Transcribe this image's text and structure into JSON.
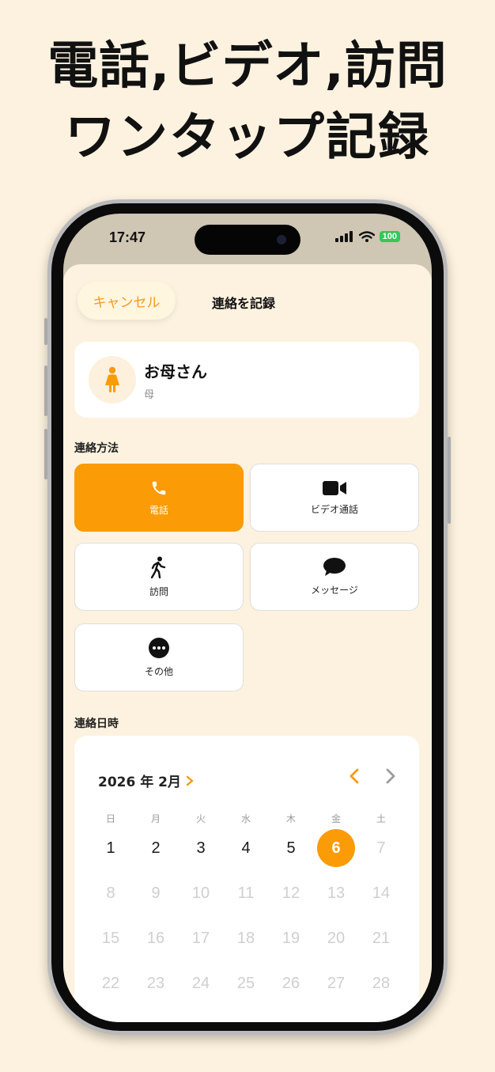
{
  "headline": {
    "line1": "電話,ビデオ,訪問",
    "line2": "ワンタップ記録"
  },
  "status_bar": {
    "time": "17:47",
    "battery": "100"
  },
  "nav": {
    "cancel_label": "キャンセル",
    "title": "連絡を記録"
  },
  "contact": {
    "name": "お母さん",
    "relation": "母",
    "avatar_icon": "woman-icon"
  },
  "contact_method": {
    "section_label": "連絡方法",
    "selected": "電話",
    "options": [
      {
        "label": "電話",
        "icon": "phone-icon"
      },
      {
        "label": "ビデオ通話",
        "icon": "video-camera-icon"
      },
      {
        "label": "訪問",
        "icon": "walking-person-icon"
      },
      {
        "label": "メッセージ",
        "icon": "message-bubble-icon"
      },
      {
        "label": "その他",
        "icon": "more-icon"
      }
    ]
  },
  "contact_datetime": {
    "section_label": "連絡日時",
    "month_label": "2026 年 2月",
    "weekdays": [
      "日",
      "月",
      "火",
      "水",
      "木",
      "金",
      "土"
    ],
    "selected_day": "6",
    "weeks": [
      [
        "1",
        "2",
        "3",
        "4",
        "5",
        "6",
        "7"
      ],
      [
        "8",
        "9",
        "10",
        "11",
        "12",
        "13",
        "14"
      ],
      [
        "15",
        "16",
        "17",
        "18",
        "19",
        "20",
        "21"
      ],
      [
        "22",
        "23",
        "24",
        "25",
        "26",
        "27",
        "28"
      ]
    ]
  },
  "colors": {
    "accent": "#fb9b05",
    "background": "#fdf2df",
    "muted_day": "#cfcfcf"
  }
}
